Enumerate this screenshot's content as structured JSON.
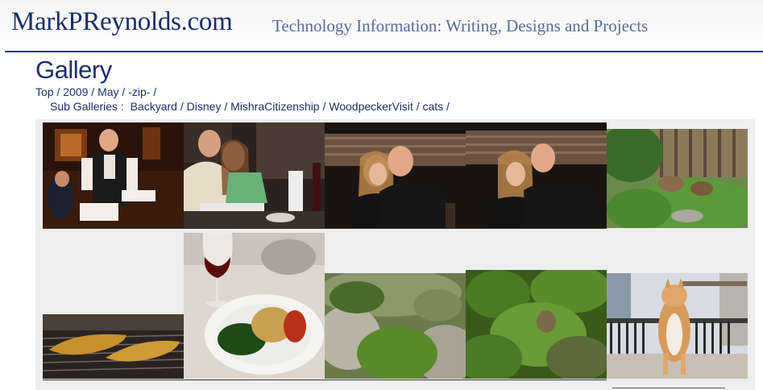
{
  "header": {
    "site_title": "MarkPReynolds.com",
    "tagline": "Technology Information:  Writing, Designs and Projects"
  },
  "page": {
    "title": "Gallery"
  },
  "breadcrumb": {
    "items": [
      "Top",
      "2009",
      "May",
      "-zip-"
    ],
    "separator": " / "
  },
  "subgalleries": {
    "label": "Sub Galleries :",
    "items": [
      "Backyard",
      "Disney",
      "MishraCitizenship",
      "WoodpeckerVisit",
      "cats"
    ]
  },
  "gallery": {
    "row1": [
      {
        "name": "restaurant-waiter-photo"
      },
      {
        "name": "couple-dinner-table-photo"
      },
      {
        "name": "couple-booth-funny-face-photo"
      },
      {
        "name": "couple-booth-smiling-photo"
      },
      {
        "name": "backyard-deer-photo"
      }
    ],
    "row2": [
      {
        "name": "grilled-fish-photo"
      },
      {
        "name": "dinner-plate-wine-photo"
      },
      {
        "name": "backyard-rocks-grass-photo"
      },
      {
        "name": "backyard-bushes-photo"
      },
      {
        "name": "cat-on-balcony-photo"
      }
    ]
  },
  "colors": {
    "link": "#1a2f6b",
    "tagline": "#5a6a9a",
    "rule": "#2a3f7a",
    "panel": "#eeeeee"
  }
}
